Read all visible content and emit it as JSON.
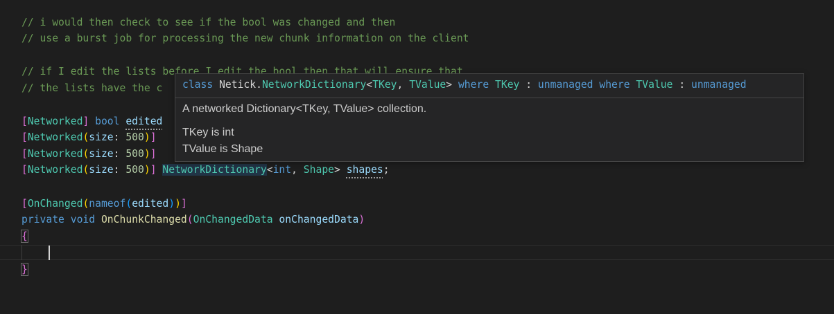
{
  "code": {
    "comment1": "// i would then check to see if the bool was changed and then",
    "comment2": "// use a burst job for processing the new chunk information on the client",
    "comment3": "// if I edit the lists before I edit the bool then that will ensure that",
    "comment4": "// the lists have the c",
    "attr_networked": "Networked",
    "kw_bool": "bool",
    "field_edited": "edited",
    "param_size": "size",
    "num_500": "500",
    "type_network_dictionary": "NetworkDictionary",
    "kw_int": "int",
    "type_shape": "Shape",
    "field_shapes": "shapes",
    "attr_onchanged": "OnChanged",
    "kw_nameof": "nameof",
    "kw_private": "private",
    "kw_void": "void",
    "method_onchunkchanged": "OnChunkChanged",
    "type_onchangeddata": "OnChangedData",
    "param_onchangeddata": "onChangedData",
    "brace_open": "{",
    "brace_close": "}"
  },
  "hover": {
    "kw_class": "class",
    "namespace": "Netick",
    "class_name": "NetworkDictionary",
    "tkey": "TKey",
    "tvalue": "TValue",
    "kw_where": "where",
    "kw_unmanaged": "unmanaged",
    "description": "A networked Dictionary<TKey, TValue> collection.",
    "tkey_info": "TKey is int",
    "tvalue_info": "TValue is Shape"
  },
  "colors": {
    "background": "#1e1e1e",
    "comment": "#6a9955",
    "keyword": "#569cd6",
    "type": "#4ec9b0",
    "parameter": "#9cdcfe",
    "number": "#b5cea8",
    "method": "#dcdcaa",
    "bracket_level1": "#da70d6",
    "bracket_level2": "#ffd700",
    "bracket_level3": "#179fff",
    "hover_background": "#252526"
  }
}
